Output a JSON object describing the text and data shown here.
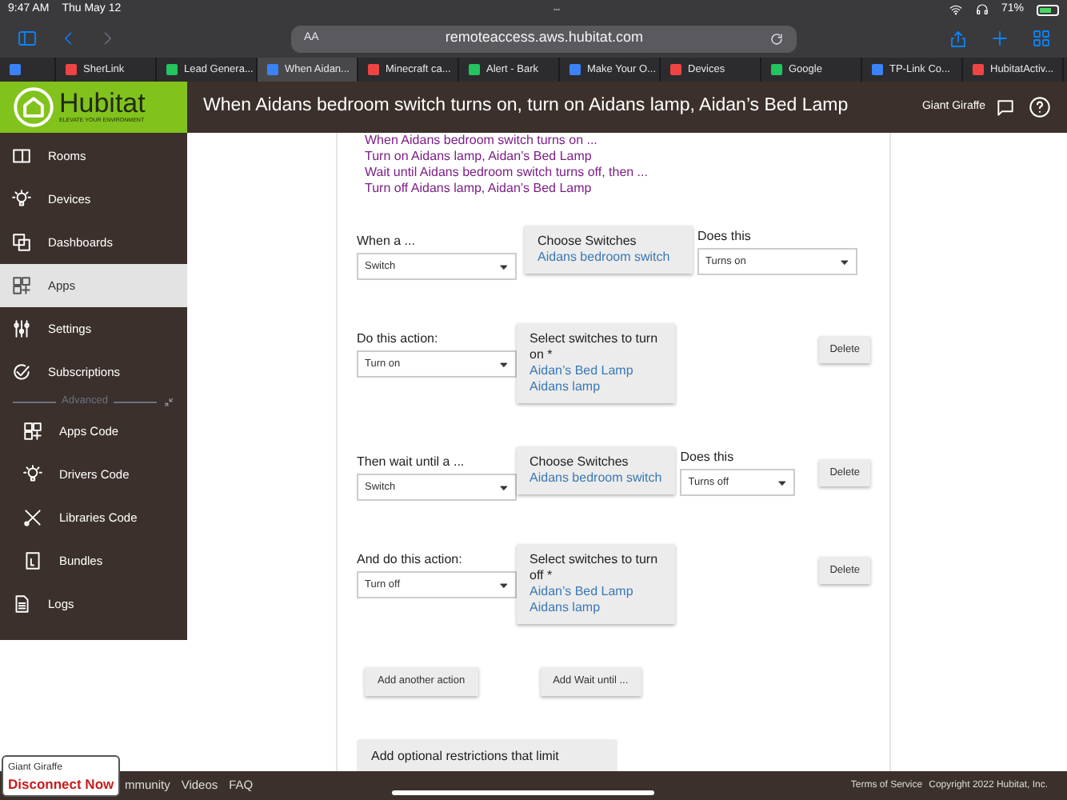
{
  "status_bar": {
    "time": "9:47 AM",
    "date": "Thu May 12",
    "battery": "71%"
  },
  "browser": {
    "text_size": "AA",
    "url": "remoteaccess.aws.hubitat.com",
    "tabs": [
      {
        "selected": false
      },
      {
        "label": "SherLink",
        "selected": false
      },
      {
        "label": "Lead Genera...",
        "selected": false
      },
      {
        "label": "When Aidan...",
        "selected": true
      },
      {
        "label": "Minecraft ca...",
        "selected": false
      },
      {
        "label": "Alert - Bark",
        "selected": false
      },
      {
        "label": "Make Your O...",
        "selected": false
      },
      {
        "label": "Devices",
        "selected": false
      },
      {
        "label": "Google",
        "selected": false
      },
      {
        "label": "TP-Link Co...",
        "selected": false
      },
      {
        "label": "HubitatActiv...",
        "selected": false
      }
    ]
  },
  "header": {
    "brand": "Hubitat",
    "tagline": "ELEVATE YOUR ENVIRONMENT",
    "title": "When Aidans bedroom switch turns on, turn on Aidans lamp, Aidan’s Bed Lamp",
    "user": "Giant Giraffe"
  },
  "sidebar": {
    "items": [
      {
        "label": "Rooms",
        "selected": false
      },
      {
        "label": "Devices",
        "selected": false
      },
      {
        "label": "Dashboards",
        "selected": false
      },
      {
        "label": "Apps",
        "selected": true
      },
      {
        "label": "Settings",
        "selected": false
      },
      {
        "label": "Subscriptions",
        "selected": false
      }
    ],
    "advanced_label": "Advanced",
    "advanced_items": [
      {
        "label": "Apps Code"
      },
      {
        "label": "Drivers Code"
      },
      {
        "label": "Libraries Code"
      },
      {
        "label": "Bundles"
      }
    ],
    "bottom_items": [
      {
        "label": "Logs"
      }
    ]
  },
  "summary": [
    "When Aidans bedroom switch turns on ...",
    "Turn on Aidans lamp, Aidan’s Bed Lamp",
    "Wait until Aidans bedroom switch turns off, then ...",
    "Turn off Aidans lamp, Aidan’s Bed Lamp"
  ],
  "rows": [
    {
      "label": "When a ...",
      "select": "Switch",
      "picker_title": "Choose Switches",
      "picker_values": [
        "Aidans bedroom switch"
      ],
      "condition_label": "Does this",
      "condition": "Turns on"
    },
    {
      "label": "Do this action:",
      "select": "Turn on",
      "picker_title": "Select switches to turn on *",
      "picker_values": [
        "Aidan’s Bed Lamp",
        "Aidans lamp"
      ],
      "delete": "Delete"
    },
    {
      "label": "Then wait until a ...",
      "select": "Switch",
      "picker_title": "Choose Switches",
      "picker_values": [
        "Aidans bedroom switch"
      ],
      "condition_label": "Does this",
      "condition": "Turns off",
      "delete": "Delete"
    },
    {
      "label": "And do this action:",
      "select": "Turn off",
      "picker_title": "Select switches to turn off *",
      "picker_values": [
        "Aidan’s Bed Lamp",
        "Aidans lamp"
      ],
      "delete": "Delete"
    }
  ],
  "buttons": [
    "Add another action",
    "Add Wait until ..."
  ],
  "restrictions": "Add optional restrictions that limit",
  "footer": {
    "links": [
      "mmunity",
      "Videos",
      "FAQ"
    ],
    "terms": "Terms of Service",
    "copyright": "Copyright 2022 Hubitat, Inc."
  },
  "remote_overlay": {
    "user": "Giant Giraffe",
    "action": "Disconnect Now"
  }
}
